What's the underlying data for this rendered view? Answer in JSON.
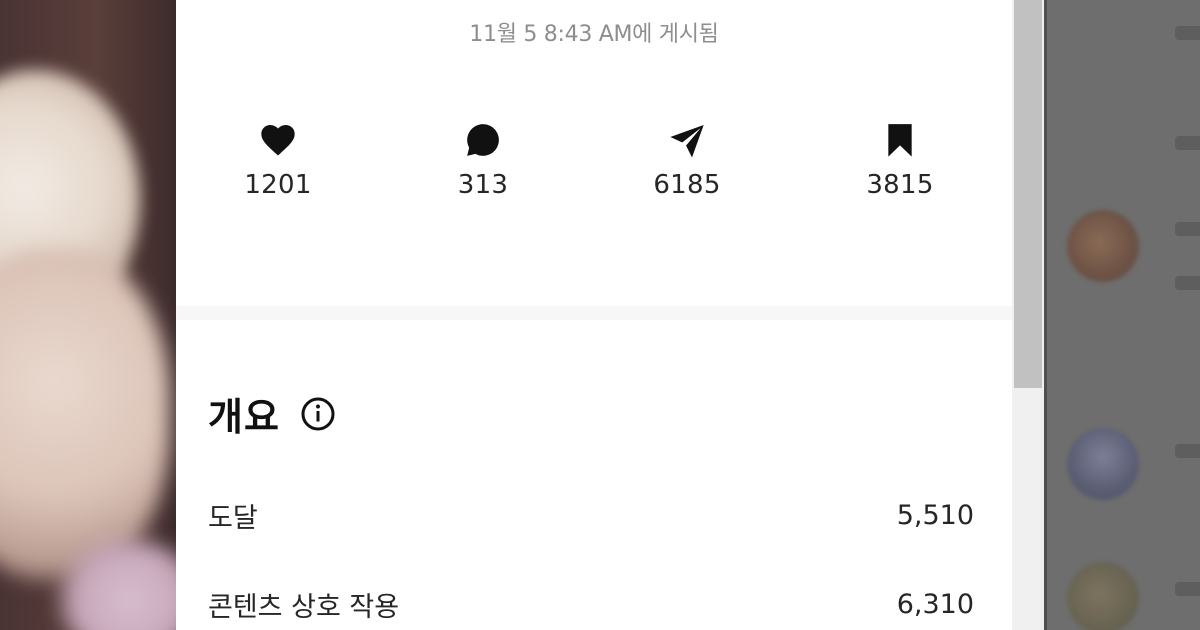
{
  "post": {
    "posted_time": "11월 5 8:43 AM에 게시됨"
  },
  "stats": [
    {
      "icon": "heart-icon",
      "count": "1201"
    },
    {
      "icon": "comment-icon",
      "count": "313"
    },
    {
      "icon": "share-icon",
      "count": "6185"
    },
    {
      "icon": "bookmark-icon",
      "count": "3815"
    }
  ],
  "overview": {
    "title": "개요",
    "info_icon": "info-icon",
    "metrics": [
      {
        "label": "도달",
        "value": "5,510"
      },
      {
        "label": "콘텐츠 상호 작용",
        "value": "6,310"
      }
    ]
  },
  "colors": {
    "panel_bg": "#ffffff",
    "muted_text": "#8e8e8e",
    "primary_text": "#262626",
    "overlay": "#6e6e6e"
  }
}
